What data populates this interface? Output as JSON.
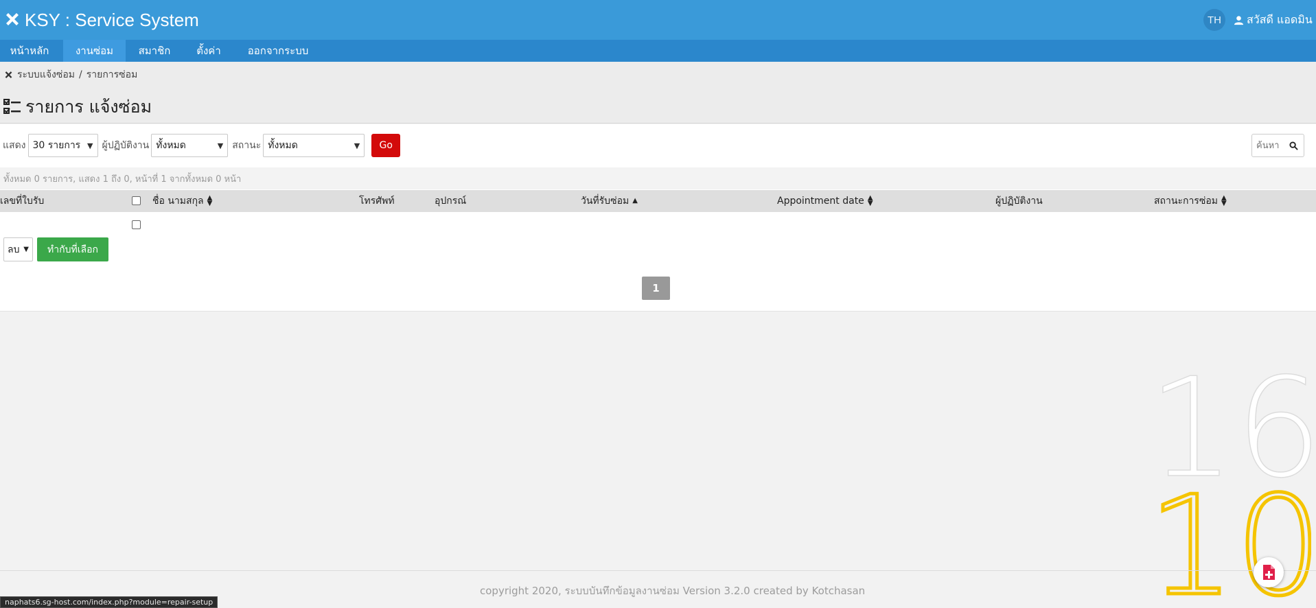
{
  "header": {
    "brand_title": "KSY : Service System",
    "language": "TH",
    "user_greeting": "สวัสดี แอดมิน"
  },
  "nav": {
    "items": [
      {
        "label": "หน้าหลัก"
      },
      {
        "label": "งานซ่อม",
        "active": true
      },
      {
        "label": "สมาชิก"
      },
      {
        "label": "ตั้งค่า"
      },
      {
        "label": "ออกจากระบบ"
      }
    ]
  },
  "breadcrumb": {
    "root": "ระบบแจ้งซ่อม",
    "separator": "/",
    "current": "รายการซ่อม"
  },
  "page": {
    "title": "รายการ แจ้งซ่อม"
  },
  "filters": {
    "show_label": "แสดง",
    "show_value": "30 รายการ",
    "operator_label": "ผู้ปฏิบัติงาน",
    "operator_value": "ทั้งหมด",
    "status_label": "สถานะ",
    "status_value": "ทั้งหมด",
    "go_label": "Go"
  },
  "search": {
    "placeholder": "ค้นหา"
  },
  "summary": {
    "text": "ทั้งหมด 0 รายการ, แสดง 1 ถึง 0, หน้าที่ 1 จากทั้งหมด 0 หน้า"
  },
  "table": {
    "columns": {
      "receipt_no": "เลขที่ใบรับ",
      "name": "ชื่อ นามสกุล",
      "phone": "โทรศัพท์",
      "device": "อุปกรณ์",
      "received_date": "วันที่รับซ่อม",
      "appointment": "Appointment date",
      "operator": "ผู้ปฏิบัติงาน",
      "repair_status": "สถานะการซ่อม"
    },
    "rows": []
  },
  "bulk_action": {
    "selected": "ลบ",
    "apply_label": "ทำกับที่เลือก"
  },
  "pagination": {
    "current": "1"
  },
  "clock": {
    "hour": "16",
    "minute": "10"
  },
  "footer": {
    "text": "copyright 2020, ระบบบันทึกข้อมูลงานซ่อม Version 3.2.0 created by Kotchasan"
  },
  "status_bar": {
    "url": "naphats6.sg-host.com/index.php?module=repair-setup"
  },
  "colors": {
    "header": "#3a9ad9",
    "nav": "#2b87cc",
    "go_button": "#d30a0a",
    "apply_button": "#3ba84a",
    "clock_hour": "#ffffff",
    "clock_minute": "#f5c400"
  }
}
